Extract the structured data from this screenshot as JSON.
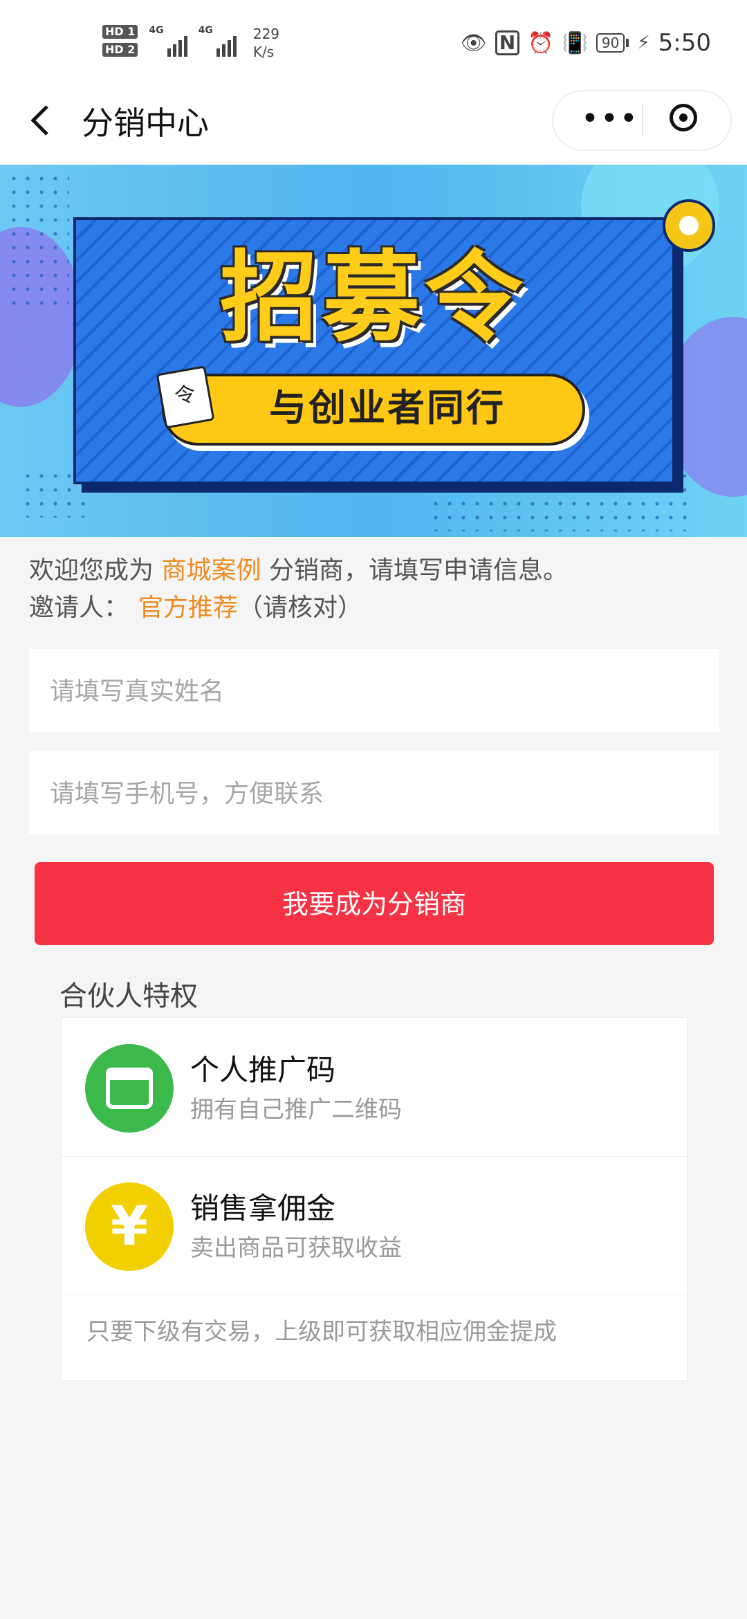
{
  "status_bar": {
    "hd1": "HD 1",
    "hd2": "HD 2",
    "net1": "4G",
    "net2": "4G",
    "speed_value": "229",
    "speed_unit": "K/s",
    "battery": "90",
    "time": "5:50",
    "icons": [
      "eye-icon",
      "nfc-icon",
      "alarm-icon",
      "vibrate-icon",
      "battery-icon",
      "charging-icon"
    ]
  },
  "nav": {
    "title": "分销中心",
    "more_icon": "•••"
  },
  "banner": {
    "title": "招募令",
    "slogan": "与创业者同行",
    "badge": "令"
  },
  "intro": {
    "line1_prefix": "欢迎您成为",
    "shop_name": "商城案例",
    "line1_suffix": "分销商，请填写申请信息。",
    "inviter_label": "邀请人：",
    "inviter_name": "官方推荐",
    "inviter_note": "（请核对）"
  },
  "form": {
    "name_placeholder": "请填写真实姓名",
    "phone_placeholder": "请填写手机号，方便联系",
    "submit_label": "我要成为分销商"
  },
  "privileges": {
    "title": "合伙人特权",
    "items": [
      {
        "name": "个人推广码",
        "desc": "拥有自己推广二维码",
        "icon": "store-icon"
      },
      {
        "name": "销售拿佣金",
        "desc": "卖出商品可获取收益",
        "icon": "yen-icon",
        "symbol": "¥"
      }
    ],
    "note": "只要下级有交易，上级即可获取相应佣金提成"
  },
  "colors": {
    "accent_orange": "#ef8b21",
    "submit_red": "#f73244",
    "green_icon": "#3cb94b",
    "yellow_icon": "#f2d000"
  }
}
